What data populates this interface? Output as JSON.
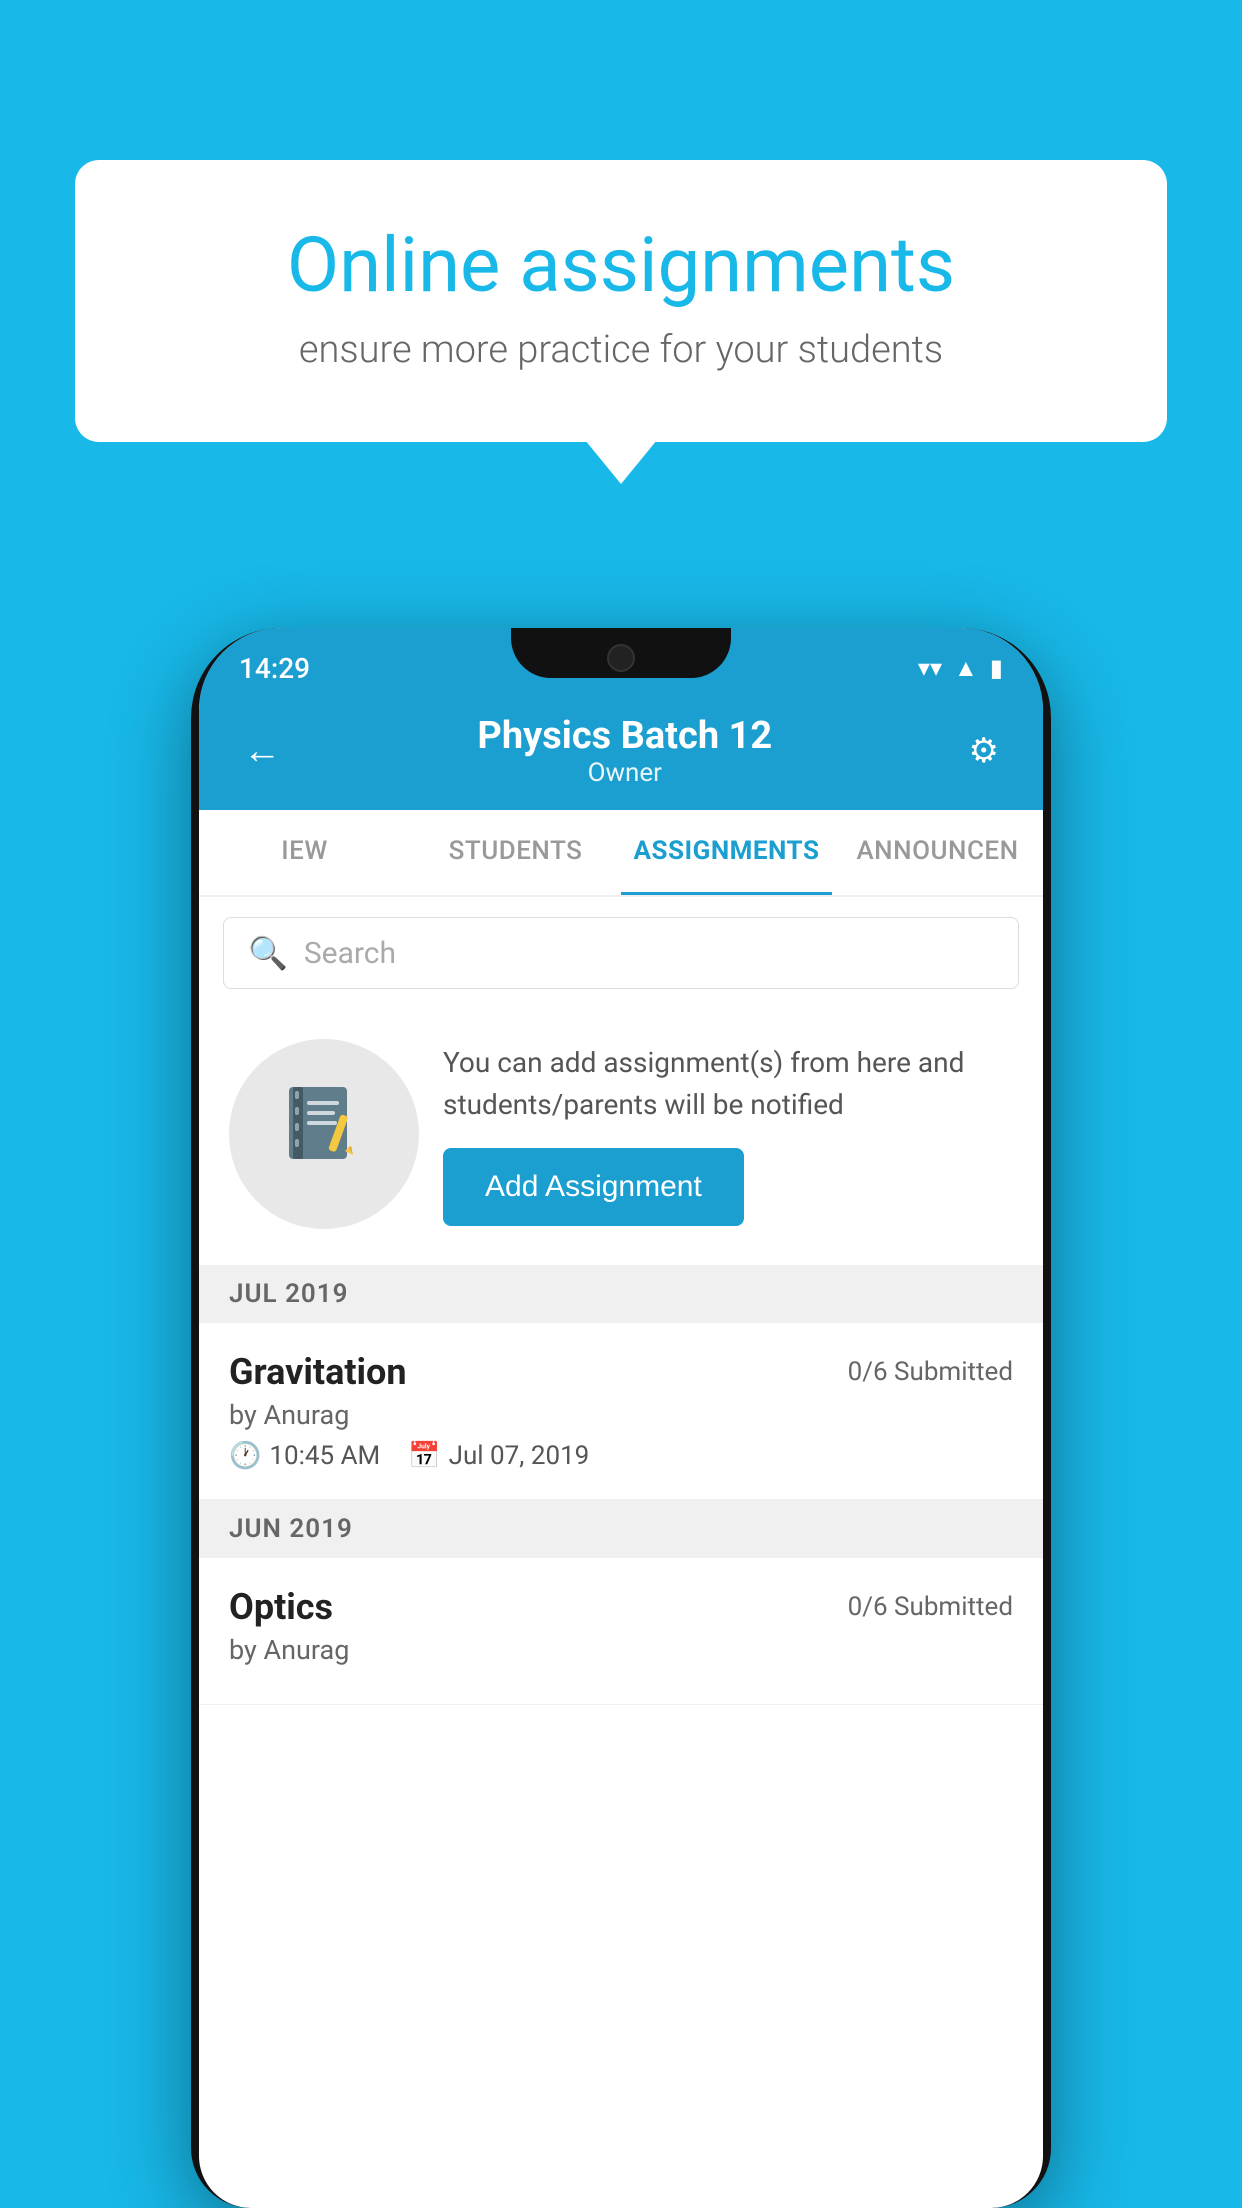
{
  "background": {
    "color": "#18b8e8"
  },
  "speech_bubble": {
    "title": "Online assignments",
    "subtitle": "ensure more practice for your students"
  },
  "status_bar": {
    "time": "14:29",
    "wifi_icon": "▼",
    "signal_icon": "▲",
    "battery_icon": "▮"
  },
  "header": {
    "back_label": "←",
    "title": "Physics Batch 12",
    "subtitle": "Owner",
    "settings_icon": "⚙"
  },
  "tabs": [
    {
      "label": "IEW",
      "active": false
    },
    {
      "label": "STUDENTS",
      "active": false
    },
    {
      "label": "ASSIGNMENTS",
      "active": true
    },
    {
      "label": "ANNOUNCEN",
      "active": false
    }
  ],
  "search": {
    "placeholder": "Search",
    "icon": "🔍"
  },
  "promo": {
    "icon": "📓",
    "text": "You can add assignment(s) from here and students/parents will be notified",
    "button_label": "Add Assignment"
  },
  "months": [
    {
      "label": "JUL 2019",
      "assignments": [
        {
          "name": "Gravitation",
          "submitted": "0/6 Submitted",
          "by": "by Anurag",
          "time": "10:45 AM",
          "date": "Jul 07, 2019"
        }
      ]
    },
    {
      "label": "JUN 2019",
      "assignments": [
        {
          "name": "Optics",
          "submitted": "0/6 Submitted",
          "by": "by Anurag",
          "time": "",
          "date": ""
        }
      ]
    }
  ]
}
